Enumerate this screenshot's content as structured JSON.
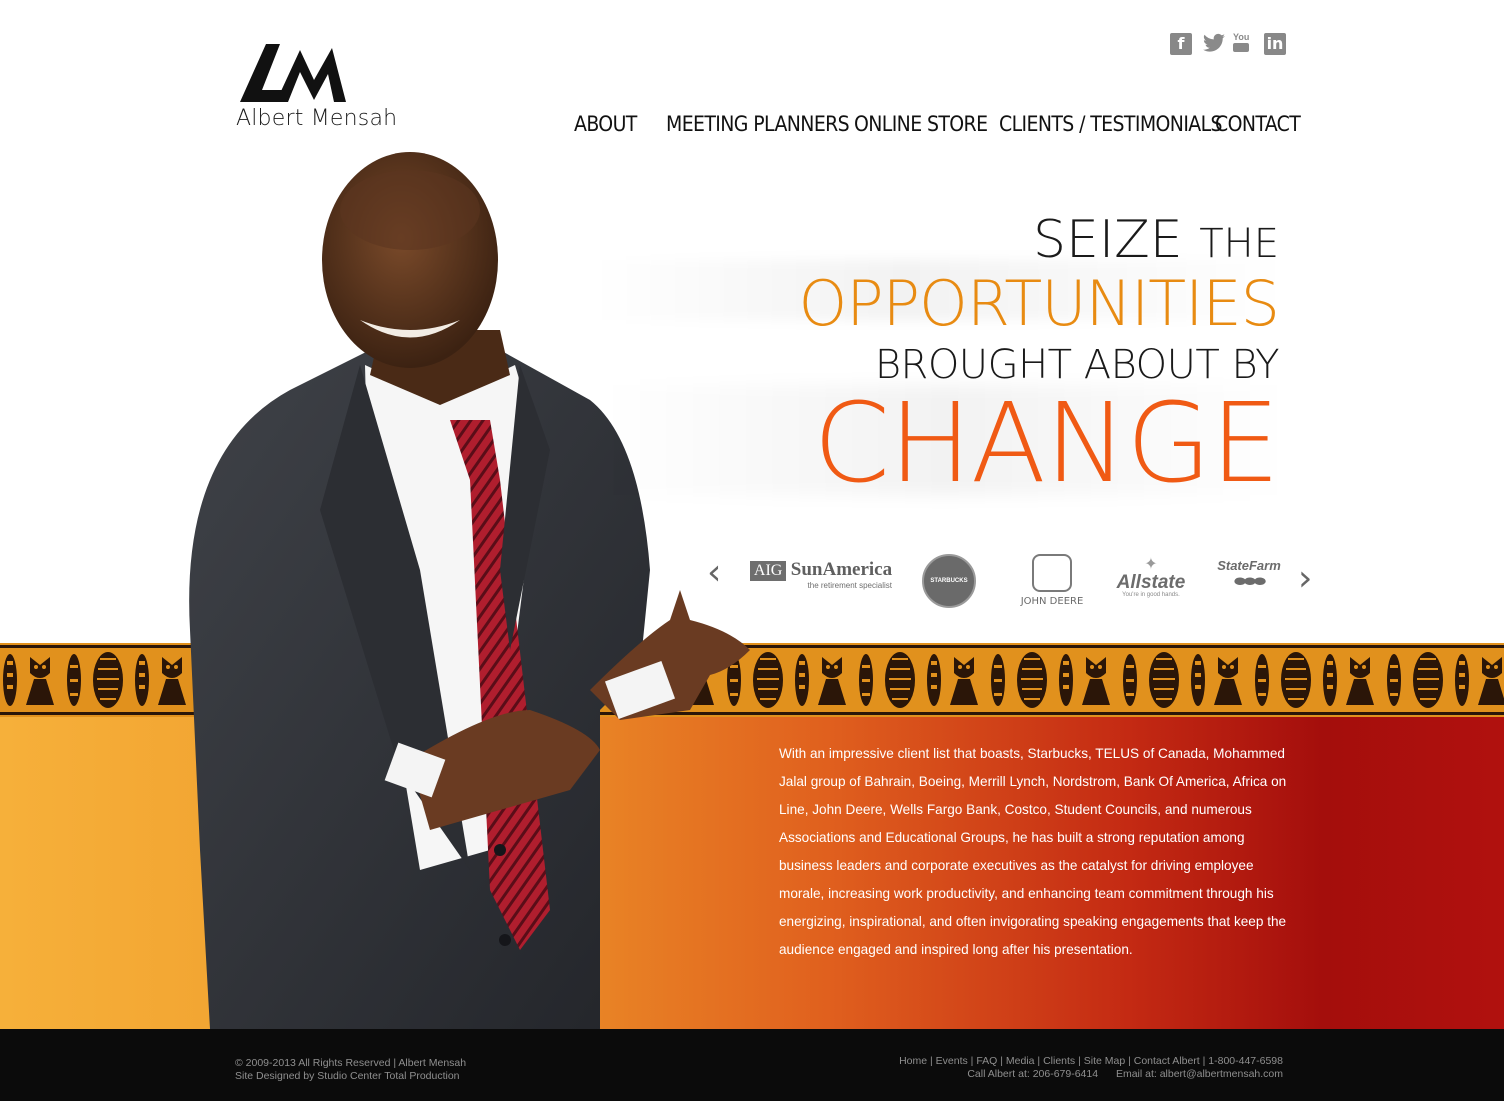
{
  "brand": {
    "logo_monogram": "AM",
    "name": "Albert Mensah"
  },
  "social": [
    {
      "name": "facebook-icon",
      "glyph": "f"
    },
    {
      "name": "twitter-icon",
      "glyph": "🐦"
    },
    {
      "name": "youtube-icon",
      "glyph": "You"
    },
    {
      "name": "linkedin-icon",
      "glyph": "in"
    }
  ],
  "nav": {
    "about": "ABOUT",
    "meeting_planners": "MEETING PLANNERS",
    "online_store": "ONLINE STORE",
    "clients": "CLIENTS / TESTIMONIALS",
    "contact": "CONTACT"
  },
  "hero": {
    "line1_a": "SEIZE",
    "line1_b": "THE",
    "line2": "OPPORTUNITIES",
    "line3": "BROUGHT ABOUT BY",
    "line4": "CHANGE",
    "colors": {
      "dark": "#1a1a1a",
      "orange_mid": "#e88b12",
      "orange_big": "#f05a14"
    }
  },
  "clients": {
    "prev": "‹",
    "next": "›",
    "logos": {
      "aig_a": "AIG",
      "aig_b": "SunAmerica",
      "aig_tag": "the retirement specialist",
      "starbucks": "STARBUCKS COFFEE",
      "johndeere": "JOHN DEERE",
      "allstate": "Allstate",
      "allstate_tag": "You're in good hands.",
      "statefarm": "StateFarm"
    }
  },
  "bio": "With an impressive client list that boasts, Starbucks, TELUS of Canada, Mohammed Jalal group of Bahrain, Boeing, Merrill Lynch, Nordstrom, Bank Of America, Africa on Line, John Deere, Wells Fargo Bank, Costco, Student Councils, and numerous Associations and Educational Groups, he has built a strong reputation among business leaders and corporate executives as the catalyst for driving employee morale, increasing work productivity, and enhancing team commitment through his energizing, inspirational, and often invigorating speaking engagements that keep the audience engaged and inspired long after his presentation.",
  "footer": {
    "copyright": "© 2009-2013 All Rights Reserved | Albert Mensah",
    "designed": "Site Designed by Studio Center Total Production",
    "links": {
      "home": "Home",
      "events": "Events",
      "faq": "FAQ",
      "media": "Media",
      "clients": "Clients",
      "sitemap": "Site Map",
      "contact": "Contact Albert",
      "sep": " | ",
      "phone": "1-800-447-6598"
    },
    "call": "Call Albert at: 206-679-6414",
    "email": "Email at: albert@albertmensah.com"
  }
}
